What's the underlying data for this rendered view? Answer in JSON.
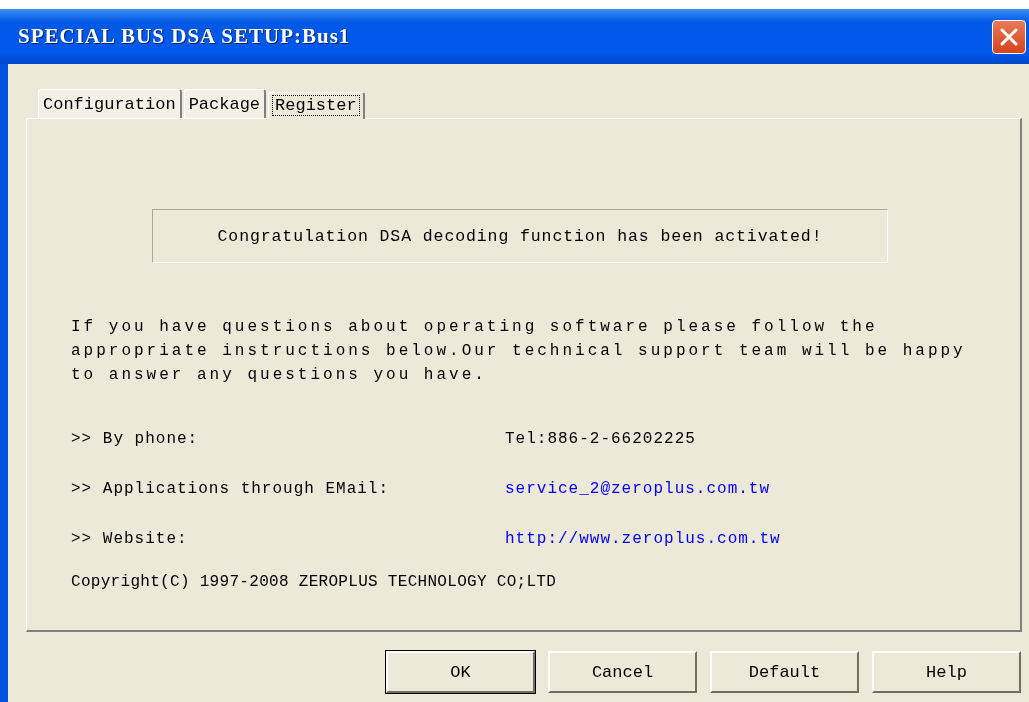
{
  "window": {
    "title": "SPECIAL BUS DSA SETUP:Bus1"
  },
  "tabs": [
    {
      "label": "Configuration",
      "selected": false
    },
    {
      "label": "Package",
      "selected": false
    },
    {
      "label": "Register",
      "selected": true
    }
  ],
  "status_message": "Congratulation DSA decoding function has been activated!",
  "intro": "If you have questions about operating software please follow the appropriate instructions below.Our technical support team will be happy to answer any questions you have.",
  "contacts": [
    {
      "marker": ">>",
      "label": "By phone:",
      "value": "Tel:886-2-66202225",
      "kind": "text"
    },
    {
      "marker": ">>",
      "label": "Applications through EMail:",
      "value": "service_2@zeroplus.com.tw",
      "kind": "link"
    },
    {
      "marker": ">>",
      "label": "Website:",
      "value": "http://www.zeroplus.com.tw",
      "kind": "link"
    }
  ],
  "copyright": "Copyright(C) 1997-2008 ZEROPLUS TECHNOLOGY CO;LTD",
  "buttons": [
    {
      "label": "OK",
      "default": true
    },
    {
      "label": "Cancel",
      "default": false
    },
    {
      "label": "Default",
      "default": false
    },
    {
      "label": "Help",
      "default": false
    }
  ]
}
